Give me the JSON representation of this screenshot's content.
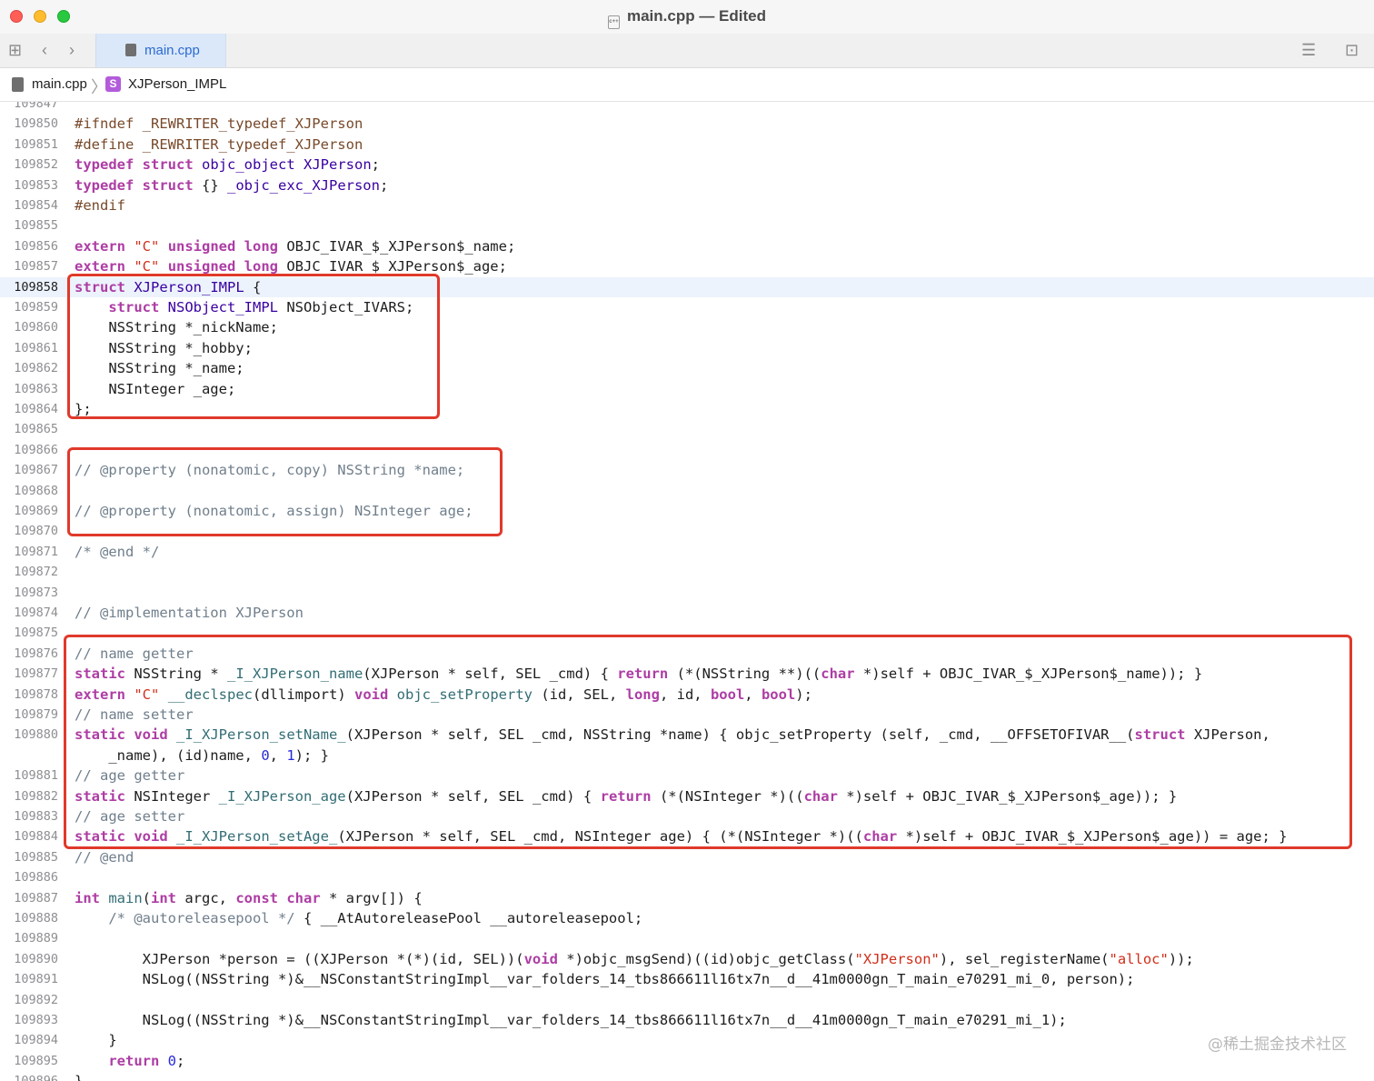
{
  "window": {
    "title": "main.cpp — Edited"
  },
  "tabbar": {
    "tab_label": "main.cpp"
  },
  "jumpbar": {
    "file": "main.cpp",
    "symbol_badge": "S",
    "symbol": "XJPerson_IMPL"
  },
  "editor": {
    "current_line": 109858,
    "lines": [
      {
        "n": "109847",
        "t": []
      },
      {
        "n": "109850",
        "t": [
          [
            "pp",
            "#ifndef _REWRITER_typedef_XJPerson"
          ]
        ]
      },
      {
        "n": "109851",
        "t": [
          [
            "pp",
            "#define _REWRITER_typedef_XJPerson"
          ]
        ]
      },
      {
        "n": "109852",
        "t": [
          [
            "kw",
            "typedef"
          ],
          [
            "",
            ""
          ],
          [
            "",
            " "
          ],
          [
            "kw",
            "struct"
          ],
          [
            "",
            " "
          ],
          [
            "ty",
            "objc_object"
          ],
          [
            "",
            " "
          ],
          [
            "ty",
            "XJPerson"
          ],
          [
            "",
            ";"
          ]
        ]
      },
      {
        "n": "109853",
        "t": [
          [
            "kw",
            "typedef"
          ],
          [
            "",
            " "
          ],
          [
            "kw",
            "struct"
          ],
          [
            "",
            " {} "
          ],
          [
            "ty",
            "_objc_exc_XJPerson"
          ],
          [
            "",
            ";"
          ]
        ]
      },
      {
        "n": "109854",
        "t": [
          [
            "pp",
            "#endif"
          ]
        ]
      },
      {
        "n": "109855",
        "t": []
      },
      {
        "n": "109856",
        "t": [
          [
            "kw",
            "extern"
          ],
          [
            "",
            " "
          ],
          [
            "st",
            "\"C\""
          ],
          [
            "",
            " "
          ],
          [
            "kw",
            "unsigned long"
          ],
          [
            "",
            " OBJC_IVAR_$_XJPerson$_name;"
          ]
        ]
      },
      {
        "n": "109857",
        "t": [
          [
            "kw",
            "extern"
          ],
          [
            "",
            " "
          ],
          [
            "st",
            "\"C\""
          ],
          [
            "",
            " "
          ],
          [
            "kw",
            "unsigned long"
          ],
          [
            "",
            " OBJC_IVAR_$_XJPerson$_age;"
          ]
        ]
      },
      {
        "n": "109858",
        "t": [
          [
            "kw",
            "struct"
          ],
          [
            "",
            " "
          ],
          [
            "ty",
            "XJPerson_IMPL"
          ],
          [
            "",
            " {"
          ]
        ]
      },
      {
        "n": "109859",
        "t": [
          [
            "",
            "    "
          ],
          [
            "kw",
            "struct"
          ],
          [
            "",
            " "
          ],
          [
            "ty",
            "NSObject_IMPL"
          ],
          [
            "",
            " NSObject_IVARS;"
          ]
        ]
      },
      {
        "n": "109860",
        "t": [
          [
            "",
            "    NSString *_nickName;"
          ]
        ]
      },
      {
        "n": "109861",
        "t": [
          [
            "",
            "    NSString *_hobby;"
          ]
        ]
      },
      {
        "n": "109862",
        "t": [
          [
            "",
            "    NSString *_name;"
          ]
        ]
      },
      {
        "n": "109863",
        "t": [
          [
            "",
            "    NSInteger _age;"
          ]
        ]
      },
      {
        "n": "109864",
        "t": [
          [
            "",
            "};"
          ]
        ]
      },
      {
        "n": "109865",
        "t": []
      },
      {
        "n": "109866",
        "t": []
      },
      {
        "n": "109867",
        "t": [
          [
            "cm",
            "// @property (nonatomic, copy) NSString *name;"
          ]
        ]
      },
      {
        "n": "109868",
        "t": []
      },
      {
        "n": "109869",
        "t": [
          [
            "cm",
            "// @property (nonatomic, assign) NSInteger age;"
          ]
        ]
      },
      {
        "n": "109870",
        "t": []
      },
      {
        "n": "109871",
        "t": [
          [
            "cm",
            "/* @end */"
          ]
        ]
      },
      {
        "n": "109872",
        "t": []
      },
      {
        "n": "109873",
        "t": []
      },
      {
        "n": "109874",
        "t": [
          [
            "cm",
            "// @implementation XJPerson"
          ]
        ]
      },
      {
        "n": "109875",
        "t": []
      },
      {
        "n": "109876",
        "t": [
          [
            "cm",
            "// name getter"
          ]
        ]
      },
      {
        "n": "109877",
        "t": [
          [
            "kw",
            "static"
          ],
          [
            "",
            " NSString * "
          ],
          [
            "fn",
            "_I_XJPerson_name"
          ],
          [
            "",
            "(XJPerson * self, SEL _cmd) { "
          ],
          [
            "kw",
            "return"
          ],
          [
            "",
            " (*(NSString **)(("
          ],
          [
            "kw",
            "char"
          ],
          [
            "",
            " *)self + OBJC_IVAR_$_XJPerson$_name)); }"
          ]
        ]
      },
      {
        "n": "109878",
        "t": [
          [
            "kw",
            "extern"
          ],
          [
            "",
            " "
          ],
          [
            "st",
            "\"C\""
          ],
          [
            "",
            " "
          ],
          [
            "fn",
            "__declspec"
          ],
          [
            "",
            "(dllimport) "
          ],
          [
            "kw",
            "void"
          ],
          [
            "",
            " "
          ],
          [
            "fn",
            "objc_setProperty"
          ],
          [
            "",
            " (id, SEL, "
          ],
          [
            "kw",
            "long"
          ],
          [
            "",
            ", id, "
          ],
          [
            "kw",
            "bool"
          ],
          [
            "",
            ", "
          ],
          [
            "kw",
            "bool"
          ],
          [
            "",
            ");"
          ]
        ]
      },
      {
        "n": "109879",
        "t": [
          [
            "cm",
            "// name setter"
          ]
        ]
      },
      {
        "n": "109880",
        "t": [
          [
            "kw",
            "static void"
          ],
          [
            "",
            " "
          ],
          [
            "fn",
            "_I_XJPerson_setName_"
          ],
          [
            "",
            "(XJPerson * self, SEL _cmd, NSString *name) { objc_setProperty (self, _cmd, __OFFSETOFIVAR__("
          ],
          [
            "kw",
            "struct"
          ],
          [
            "",
            " XJPerson,"
          ]
        ]
      },
      {
        "n": "",
        "t": [
          [
            "",
            "    _name), (id)name, "
          ],
          [
            "nm",
            "0"
          ],
          [
            "",
            ", "
          ],
          [
            "nm",
            "1"
          ],
          [
            "",
            "); }"
          ]
        ]
      },
      {
        "n": "109881",
        "t": [
          [
            "cm",
            "// age getter"
          ]
        ]
      },
      {
        "n": "109882",
        "t": [
          [
            "kw",
            "static"
          ],
          [
            "",
            " NSInteger "
          ],
          [
            "fn",
            "_I_XJPerson_age"
          ],
          [
            "",
            "(XJPerson * self, SEL _cmd) { "
          ],
          [
            "kw",
            "return"
          ],
          [
            "",
            " (*(NSInteger *)(("
          ],
          [
            "kw",
            "char"
          ],
          [
            "",
            " *)self + OBJC_IVAR_$_XJPerson$_age)); }"
          ]
        ]
      },
      {
        "n": "109883",
        "t": [
          [
            "cm",
            "// age setter"
          ]
        ]
      },
      {
        "n": "109884",
        "t": [
          [
            "kw",
            "static void"
          ],
          [
            "",
            " "
          ],
          [
            "fn",
            "_I_XJPerson_setAge_"
          ],
          [
            "",
            "(XJPerson * self, SEL _cmd, NSInteger age) { (*(NSInteger *)(("
          ],
          [
            "kw",
            "char"
          ],
          [
            "",
            " *)self + OBJC_IVAR_$_XJPerson$_age)) = age; }"
          ]
        ]
      },
      {
        "n": "109885",
        "t": [
          [
            "cm",
            "// @end"
          ]
        ]
      },
      {
        "n": "109886",
        "t": []
      },
      {
        "n": "109887",
        "t": [
          [
            "kw",
            "int"
          ],
          [
            "",
            " "
          ],
          [
            "fn",
            "main"
          ],
          [
            "",
            "("
          ],
          [
            "kw",
            "int"
          ],
          [
            "",
            " argc, "
          ],
          [
            "kw",
            "const char"
          ],
          [
            "",
            " * argv[]) {"
          ]
        ]
      },
      {
        "n": "109888",
        "t": [
          [
            "",
            "    "
          ],
          [
            "cm",
            "/* @autoreleasepool */"
          ],
          [
            "",
            " { __AtAutoreleasePool __autoreleasepool;"
          ]
        ]
      },
      {
        "n": "109889",
        "t": []
      },
      {
        "n": "109890",
        "t": [
          [
            "",
            "        XJPerson *person = ((XJPerson *(*)(id, SEL))("
          ],
          [
            "kw",
            "void"
          ],
          [
            "",
            " *)objc_msgSend)((id)objc_getClass("
          ],
          [
            "st",
            "\"XJPerson\""
          ],
          [
            "",
            "), sel_registerName("
          ],
          [
            "st",
            "\"alloc\""
          ],
          [
            "",
            "));"
          ]
        ]
      },
      {
        "n": "109891",
        "t": [
          [
            "",
            "        NSLog((NSString *)&__NSConstantStringImpl__var_folders_14_tbs866611l16tx7n__d__41m0000gn_T_main_e70291_mi_0, person);"
          ]
        ]
      },
      {
        "n": "109892",
        "t": []
      },
      {
        "n": "109893",
        "t": [
          [
            "",
            "        NSLog((NSString *)&__NSConstantStringImpl__var_folders_14_tbs866611l16tx7n__d__41m0000gn_T_main_e70291_mi_1);"
          ]
        ]
      },
      {
        "n": "109894",
        "t": [
          [
            "",
            "    }"
          ]
        ]
      },
      {
        "n": "109895",
        "t": [
          [
            "",
            "    "
          ],
          [
            "kw",
            "return"
          ],
          [
            "",
            " "
          ],
          [
            "nm",
            "0"
          ],
          [
            "",
            ";"
          ]
        ]
      },
      {
        "n": "109896",
        "t": [
          [
            "",
            "}"
          ]
        ]
      }
    ]
  },
  "watermark": "@稀土掘金技术社区"
}
